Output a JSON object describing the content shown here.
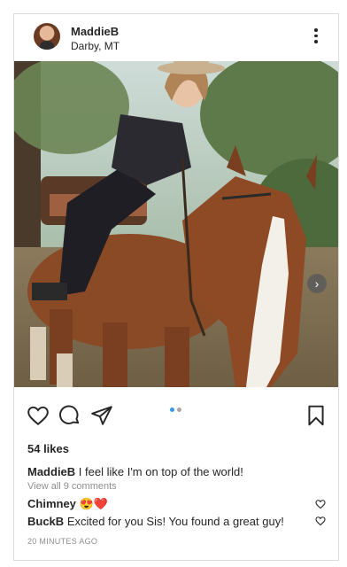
{
  "post": {
    "username": "MaddieB",
    "location": "Darby, MT",
    "likes": "54 likes",
    "caption_user": "MaddieB",
    "caption_text": "I feel like I'm on top of the world!",
    "view_comments": "View all 9 comments",
    "comments": [
      {
        "user": "Chimney",
        "text": "😍❤️"
      },
      {
        "user": "BuckB",
        "text": "Excited for you Sis! You found a great guy!"
      }
    ],
    "timestamp": "20 MINUTES AGO",
    "carousel": {
      "count": 2,
      "active_index": 0
    }
  },
  "icons": {
    "more": "more-vertical-icon",
    "next": "chevron-right-icon",
    "like": "heart-icon",
    "comment": "comment-bubble-icon",
    "share": "paper-plane-icon",
    "save": "bookmark-icon"
  },
  "colors": {
    "active_dot": "#3897f0",
    "inactive_dot": "#a8a8a8",
    "text": "#262626",
    "muted": "#8e8e8e"
  }
}
